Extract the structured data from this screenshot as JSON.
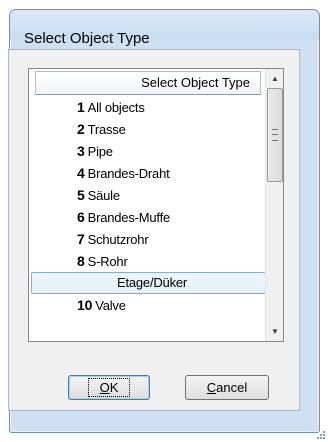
{
  "window": {
    "title": "Select Object Type"
  },
  "listbox": {
    "column_header": "Select Object Type",
    "items": [
      {
        "number": "1",
        "label": "All objects"
      },
      {
        "number": "2",
        "label": "Trasse"
      },
      {
        "number": "3",
        "label": "Pipe"
      },
      {
        "number": "4",
        "label": "Brandes-Draht"
      },
      {
        "number": "5",
        "label": "Säule"
      },
      {
        "number": "6",
        "label": "Brandes-Muffe"
      },
      {
        "number": "7",
        "label": "Schutzrohr"
      },
      {
        "number": "8",
        "label": "S-Rohr"
      },
      {
        "number": "",
        "label": "Etage/Düker"
      },
      {
        "number": "10",
        "label": "Valve"
      }
    ],
    "selected_label": "Etage/Düker",
    "scroll_position": 0.0
  },
  "buttons": {
    "ok_mnemonic": "O",
    "ok_rest": "K",
    "cancel_mnemonic": "C",
    "cancel_rest": "ancel"
  },
  "icons": {
    "scroll_up": "arrow-up-icon",
    "scroll_down": "arrow-down-icon",
    "thumb_grip": "grip-icon",
    "resize": "resize-grip-icon"
  },
  "colors": {
    "selection_fill": "#e3f0fb",
    "selection_border": "#84acdd",
    "window_frame": "#cfe0f2",
    "default_button_border": "#3c7fb1"
  }
}
